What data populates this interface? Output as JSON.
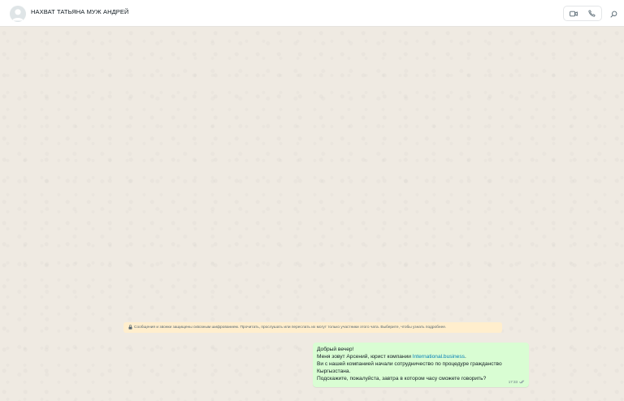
{
  "header": {
    "chat_title": "НАХВАТ ТАТЬЯНА МУЖ АНДРЕЙ"
  },
  "icons": {
    "avatar": "default-user-avatar",
    "video_call": "video-camera-icon",
    "voice_call": "phone-icon",
    "search": "search-icon",
    "encryption": "lock-icon",
    "delivery_status": "double-check-icon"
  },
  "encryption_notice": {
    "text": "Сообщения и звонки защищены сквозным шифрованием. Прочитать, прослушать или переслать их могут только участники этого чата. Выберите, чтобы узнать подробнее."
  },
  "message": {
    "line1": "Добрый вечер!",
    "line2_prefix": "Меня зовут Арсений, юрист компании ",
    "line2_link": "International.business",
    "line2_suffix": ".",
    "line3": "Ви с нашей компанией начали сотрудничество по процедуре гражданство",
    "line4": "Кыргызстана.",
    "line5": "Подскажите, пожалуйста, завтра в котором часу сможете говорить?",
    "time": "17:33",
    "status": "delivered"
  },
  "colors": {
    "wallpaper": "#efeae2",
    "outgoing_bubble": "#d9fdd3",
    "notice_background": "#ffeecd",
    "link": "#027eb5",
    "header_background": "#ffffff"
  }
}
